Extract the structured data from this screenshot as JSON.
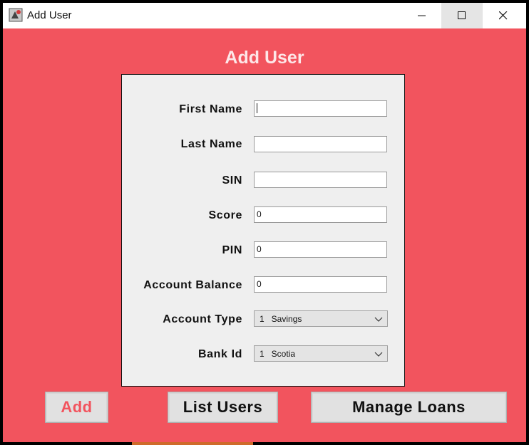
{
  "window": {
    "title": "Add User"
  },
  "form": {
    "heading": "Add User",
    "fields": [
      {
        "label": "First Name",
        "value": "",
        "type": "text",
        "focused": true
      },
      {
        "label": "Last Name",
        "value": "",
        "type": "text"
      },
      {
        "label": "SIN",
        "value": "",
        "type": "text"
      },
      {
        "label": "Score",
        "value": "0",
        "type": "text"
      },
      {
        "label": "PIN",
        "value": "0",
        "type": "text"
      },
      {
        "label": "Account Balance",
        "value": "0",
        "type": "text"
      },
      {
        "label": "Account Type",
        "value": "1   Savings",
        "type": "select"
      },
      {
        "label": "Bank Id",
        "value": "1   Scotia",
        "type": "select"
      }
    ]
  },
  "buttons": {
    "add": "Add",
    "list_users": "List Users",
    "manage_loans": "Manage Loans"
  },
  "colors": {
    "background": "#f2545e",
    "panel": "#efefef",
    "add_text": "#f2545e"
  }
}
